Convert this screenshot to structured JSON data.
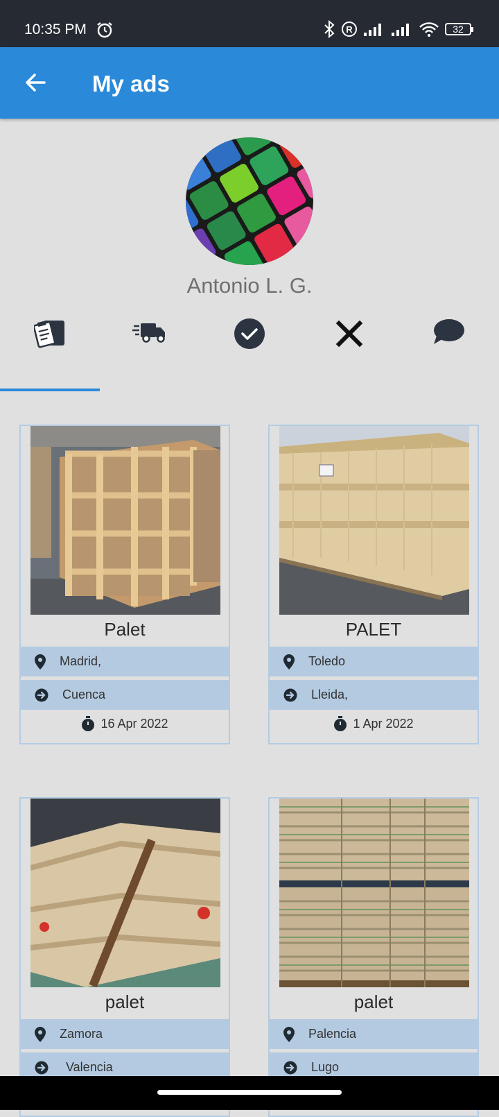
{
  "status": {
    "time": "10:35 PM",
    "battery": "32"
  },
  "appbar": {
    "title": "My ads"
  },
  "profile": {
    "name": "Antonio L. G."
  },
  "tabs": [
    {
      "icon": "ads-list-icon"
    },
    {
      "icon": "truck-icon"
    },
    {
      "icon": "check-circle-icon"
    },
    {
      "icon": "close-icon"
    },
    {
      "icon": "chat-bubble-icon"
    }
  ],
  "ads": [
    {
      "title": "Palet",
      "from": "Madrid,",
      "to": "Cuenca",
      "date": "16 Apr 2022"
    },
    {
      "title": "PALET",
      "from": "Toledo",
      "to": "Lleida,",
      "date": "1 Apr 2022"
    },
    {
      "title": "palet",
      "from": "Zamora",
      "to": " Valencia",
      "date": ""
    },
    {
      "title": "palet",
      "from": "Palencia",
      "to": "Lugo",
      "date": ""
    }
  ],
  "colors": {
    "primary": "#2a8ad9",
    "status_bar": "#262b33",
    "row_bg": "#b3cae0",
    "card_border": "#b3cce3"
  }
}
